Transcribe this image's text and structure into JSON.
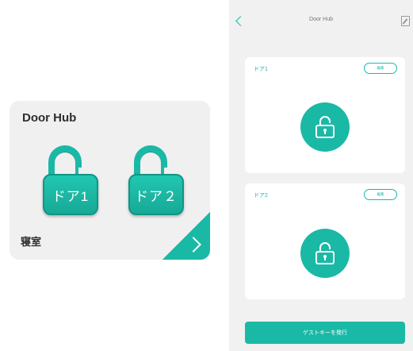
{
  "colors": {
    "accent": "#1ab9a6",
    "card": "#f0f0f0",
    "screen": "#f1f1f1"
  },
  "widget": {
    "title": "Door Hub",
    "doors": [
      {
        "label": "ドア1"
      },
      {
        "label": "ドア２"
      }
    ],
    "room": "寝室",
    "corner_icon": "chevron-right-icon"
  },
  "app": {
    "nav": {
      "title": "Door Hub",
      "back_icon": "chevron-left-icon",
      "edit_icon": "edit-icon"
    },
    "doors": [
      {
        "name": "ドア1",
        "edit_label": "編集",
        "lock_icon": "padlock-unlocked-icon"
      },
      {
        "name": "ドア2",
        "edit_label": "編集",
        "lock_icon": "padlock-unlocked-icon"
      }
    ],
    "guest_key_label": "ゲストキーを発行"
  }
}
